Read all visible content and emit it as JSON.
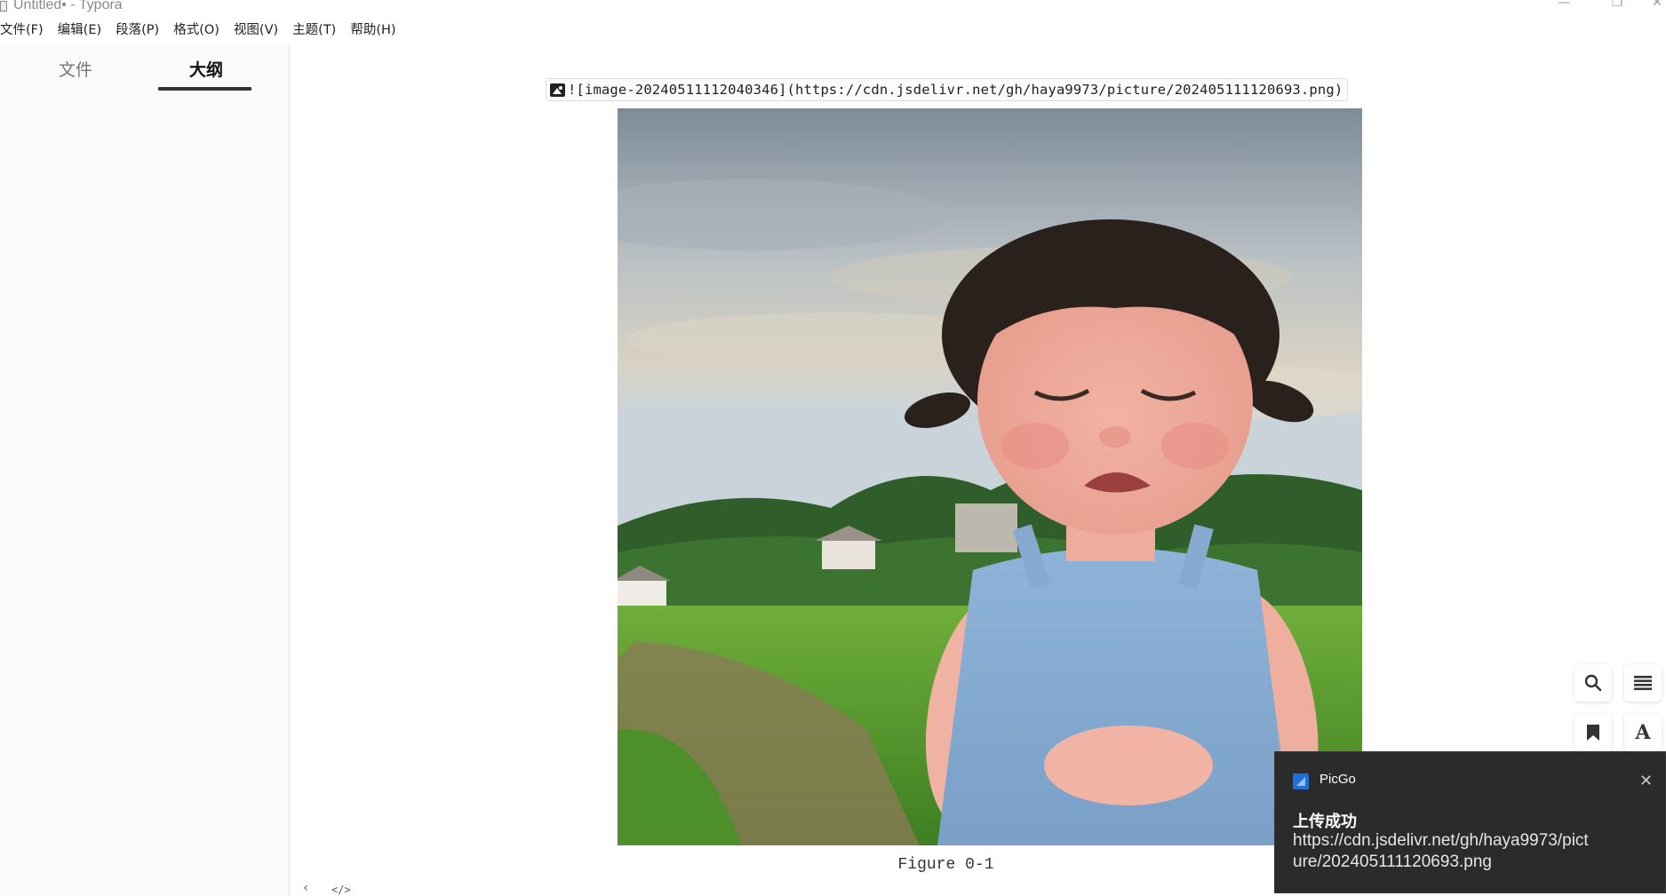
{
  "window": {
    "title": "Untitled• - Typora",
    "minimize_glyph": "—",
    "restore_glyph": "❐",
    "close_glyph": "✕"
  },
  "menubar": {
    "items": [
      "文件(F)",
      "编辑(E)",
      "段落(P)",
      "格式(O)",
      "视图(V)",
      "主题(T)",
      "帮助(H)"
    ]
  },
  "sidebar": {
    "tabs": [
      {
        "label": "文件",
        "active": false
      },
      {
        "label": "大纲",
        "active": true
      }
    ]
  },
  "editor": {
    "markdown_source": "![image-20240511112040346](https://cdn.jsdelivr.net/gh/haya9973/picture/202405111120693.png)",
    "caption": "Figure 0-1",
    "back_glyph": "‹",
    "source_toggle_glyph": "</>"
  },
  "image": {
    "icon": "image-icon"
  },
  "float_tools": {
    "search_icon": "search-icon",
    "outline_icon": "list-icon",
    "bookmark_icon": "bookmark-icon",
    "font_icon": "font-icon",
    "font_glyph": "A"
  },
  "toast": {
    "app_name": "PicGo",
    "heading": "上传成功",
    "url": "https://cdn.jsdelivr.net/gh/haya9973/picture/202405111120693.png",
    "close_glyph": "✕",
    "background": "#2b2b2b"
  }
}
